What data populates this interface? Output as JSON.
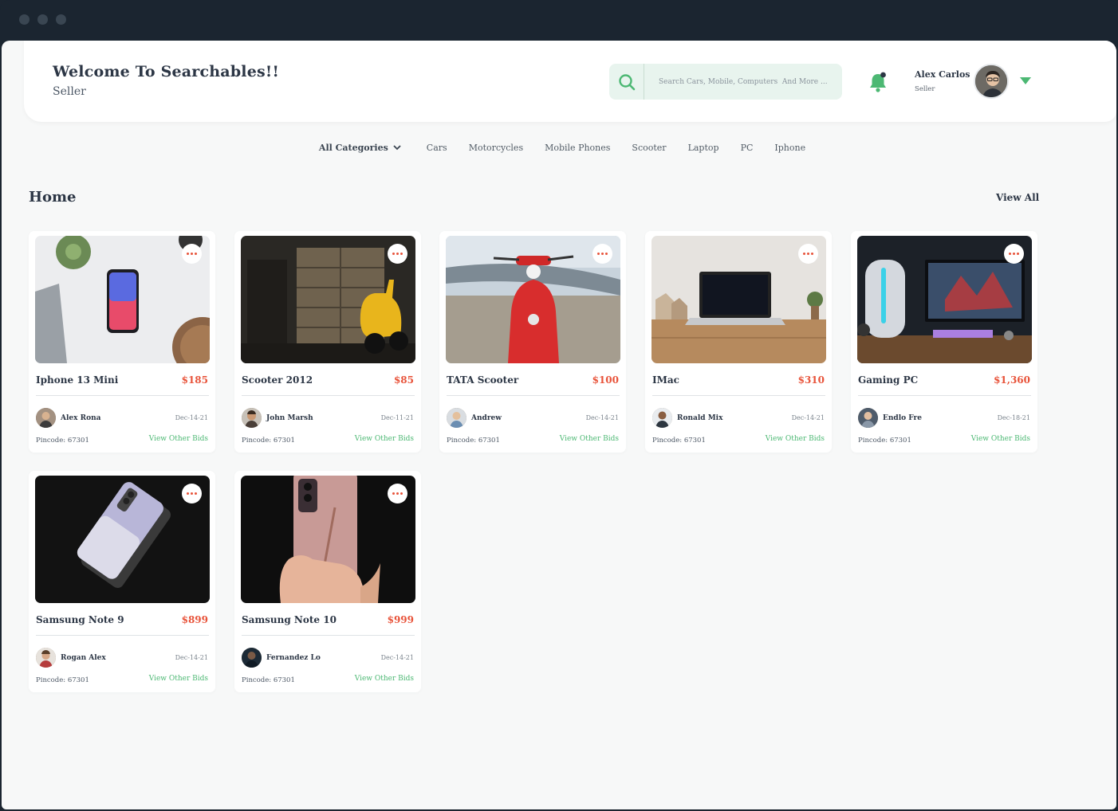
{
  "header": {
    "title": "Welcome To Searchables!!",
    "subtitle": "Seller",
    "search_placeholder": "Search Cars, Mobile, Computers  And More ...",
    "user_name": "Alex Carlos",
    "user_role": "Seller",
    "icons": {
      "search": "search-icon",
      "bell": "bell-icon",
      "caret": "chevron-down-icon"
    }
  },
  "categories": {
    "all_label": "All Categories",
    "items": [
      "Cars",
      "Motorcycles",
      "Mobile Phones",
      "Scooter",
      "Laptop",
      "PC",
      "Iphone"
    ]
  },
  "main": {
    "title": "Home",
    "view_all": "View All"
  },
  "colors": {
    "accent": "#4cb873",
    "price": "#e8533a",
    "text": "#2c3645"
  },
  "cards": [
    {
      "title": "Iphone 13 Mini",
      "price": "$185",
      "seller": "Alex Rona",
      "date": "Dec-14-21",
      "pincode": "Pincode: 67301",
      "bids_label": "View Other Bids"
    },
    {
      "title": "Scooter 2012",
      "price": "$85",
      "seller": "John Marsh",
      "date": "Dec-11-21",
      "pincode": "Pincode: 67301",
      "bids_label": "View Other Bids"
    },
    {
      "title": "TATA Scooter",
      "price": "$100",
      "seller": "Andrew",
      "date": "Dec-14-21",
      "pincode": "Pincode: 67301",
      "bids_label": "View Other Bids"
    },
    {
      "title": "IMac",
      "price": "$310",
      "seller": "Ronald Mix",
      "date": "Dec-14-21",
      "pincode": "Pincode: 67301",
      "bids_label": "View Other Bids"
    },
    {
      "title": "Gaming PC",
      "price": "$1,360",
      "seller": "Endlo Fre",
      "date": "Dec-18-21",
      "pincode": "Pincode: 67301",
      "bids_label": "View Other Bids"
    },
    {
      "title": "Samsung Note 9",
      "price": "$899",
      "seller": "Rogan Alex",
      "date": "Dec-14-21",
      "pincode": "Pincode: 67301",
      "bids_label": "View Other Bids"
    },
    {
      "title": "Samsung Note 10",
      "price": "$999",
      "seller": "Fernandez Lo",
      "date": "Dec-14-21",
      "pincode": "Pincode: 67301",
      "bids_label": "View Other Bids"
    }
  ]
}
